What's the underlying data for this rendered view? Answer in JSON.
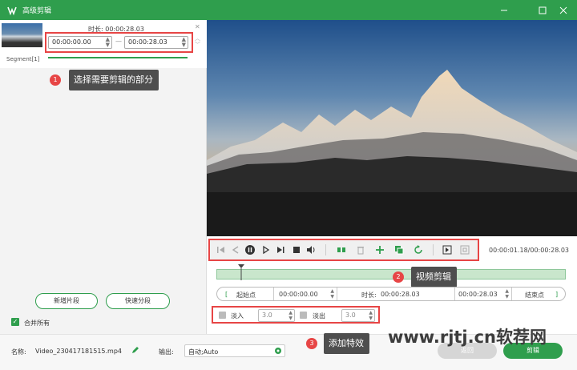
{
  "window": {
    "title": "高级剪辑"
  },
  "segment": {
    "duration_label": "时长:",
    "duration_value": "00:00:28.03",
    "start": "00:00:00.00",
    "end": "00:00:28.03",
    "separator": "—",
    "label": "Segment[1]"
  },
  "callouts": [
    {
      "num": "1",
      "text": "选择需要剪辑的部分"
    },
    {
      "num": "2",
      "text": "视频剪辑"
    },
    {
      "num": "3",
      "text": "添加特效"
    }
  ],
  "left_buttons": {
    "new_segment": "新增片段",
    "quick_split": "快速分段"
  },
  "merge": {
    "label": "合并所有"
  },
  "playback": {
    "time": "00:00:01.18/00:00:28.03"
  },
  "range": {
    "start_label": "起始点",
    "start_value": "00:00:00.00",
    "duration_label": "时长:",
    "duration_value": "00:00:28.03",
    "end_value": "00:00:28.03",
    "end_label": "结束点",
    "bracket_open": "[",
    "bracket_close": "]"
  },
  "effects": {
    "fade_in_label": "淡入",
    "fade_in_value": "3.0",
    "fade_out_label": "淡出",
    "fade_out_value": "3.0"
  },
  "footer": {
    "name_label": "名称:",
    "name_value": "Video_230417181515.mp4",
    "output_label": "输出:",
    "output_value": "自动;Auto",
    "back": "返回",
    "cut": "剪辑"
  },
  "watermark": "www.rjtj.cn软荐网",
  "colors": {
    "brand": "#2f9e4d",
    "callout_badge": "#e74545"
  }
}
